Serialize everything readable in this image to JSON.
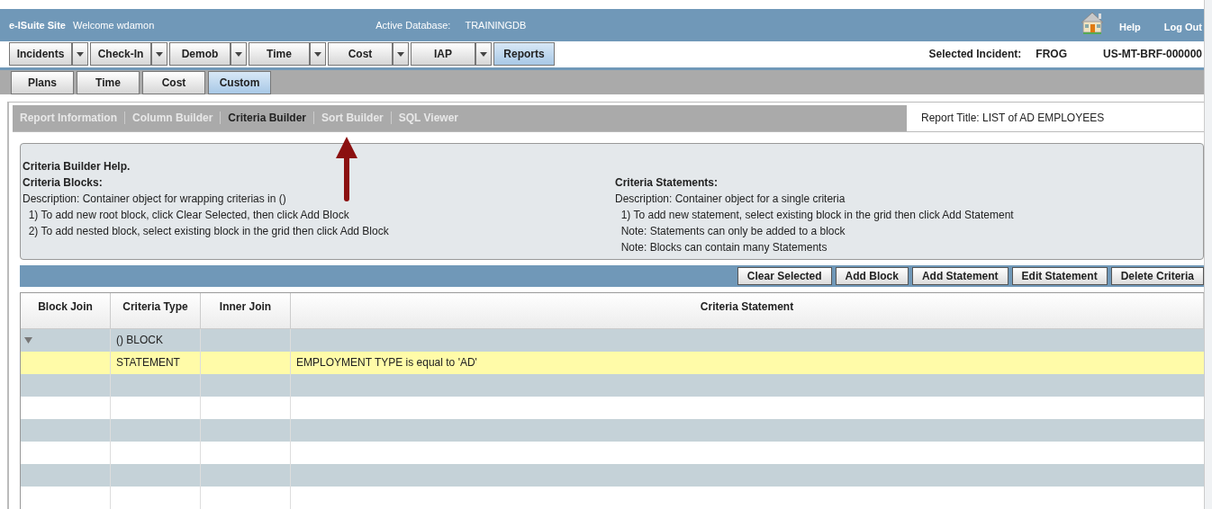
{
  "header": {
    "site": "e-ISuite Site",
    "welcome": "Welcome wdamon",
    "database_label": "Active Database:",
    "database": "TRAININGDB",
    "links": [
      "Help",
      "Log Out"
    ]
  },
  "main_menu": [
    {
      "label": "Incidents",
      "dropdown": true,
      "selected": false
    },
    {
      "label": "Check-In",
      "dropdown": true,
      "selected": false
    },
    {
      "label": "Demob",
      "dropdown": true,
      "selected": false
    },
    {
      "label": "Time",
      "dropdown": true,
      "selected": false
    },
    {
      "label": "Cost",
      "dropdown": true,
      "selected": false
    },
    {
      "label": "IAP",
      "dropdown": true,
      "selected": false
    },
    {
      "label": "Reports",
      "dropdown": false,
      "selected": true
    }
  ],
  "selected_incident": {
    "label": "Selected Incident:",
    "name": "FROG",
    "number": "US-MT-BRF-000000"
  },
  "sub_menu": [
    {
      "label": "Plans",
      "selected": false
    },
    {
      "label": "Time",
      "selected": false
    },
    {
      "label": "Cost",
      "selected": false
    },
    {
      "label": "Custom",
      "selected": true
    }
  ],
  "builder_tabs": [
    {
      "label": "Report Information",
      "selected": false
    },
    {
      "label": "Column Builder",
      "selected": false
    },
    {
      "label": "Criteria Builder",
      "selected": true
    },
    {
      "label": "Sort Builder",
      "selected": false
    },
    {
      "label": "SQL Viewer",
      "selected": false
    }
  ],
  "report_title": "Report Title: LIST of AD EMPLOYEES",
  "help": {
    "title": "Criteria Builder Help.",
    "left": {
      "heading": "Criteria Blocks:",
      "lines": [
        "Description: Container object for wrapping criterias in ()",
        "  1) To add new root block, click Clear Selected, then click Add Block",
        "  2) To add nested block, select existing block in the grid then click Add Block"
      ]
    },
    "right": {
      "heading": "Criteria Statements:",
      "lines": [
        "Description: Container object for a single criteria",
        "  1) To add new statement, select existing block in the grid then click Add Statement",
        "  Note: Statements can only be added to a block",
        "  Note: Blocks can contain many Statements"
      ]
    }
  },
  "toolbar_buttons": [
    "Clear Selected",
    "Add Block",
    "Add Statement",
    "Edit Statement",
    "Delete Criteria"
  ],
  "table": {
    "columns": [
      "Block Join",
      "Criteria Type",
      "Inner Join",
      "Criteria Statement"
    ],
    "rows": [
      {
        "criteria_type": "() BLOCK",
        "expanded": true,
        "selected": false,
        "children": [
          {
            "criteria_type": "STATEMENT",
            "criteria_statement": "EMPLOYMENT TYPE is equal to 'AD'",
            "selected": true
          }
        ]
      }
    ]
  }
}
